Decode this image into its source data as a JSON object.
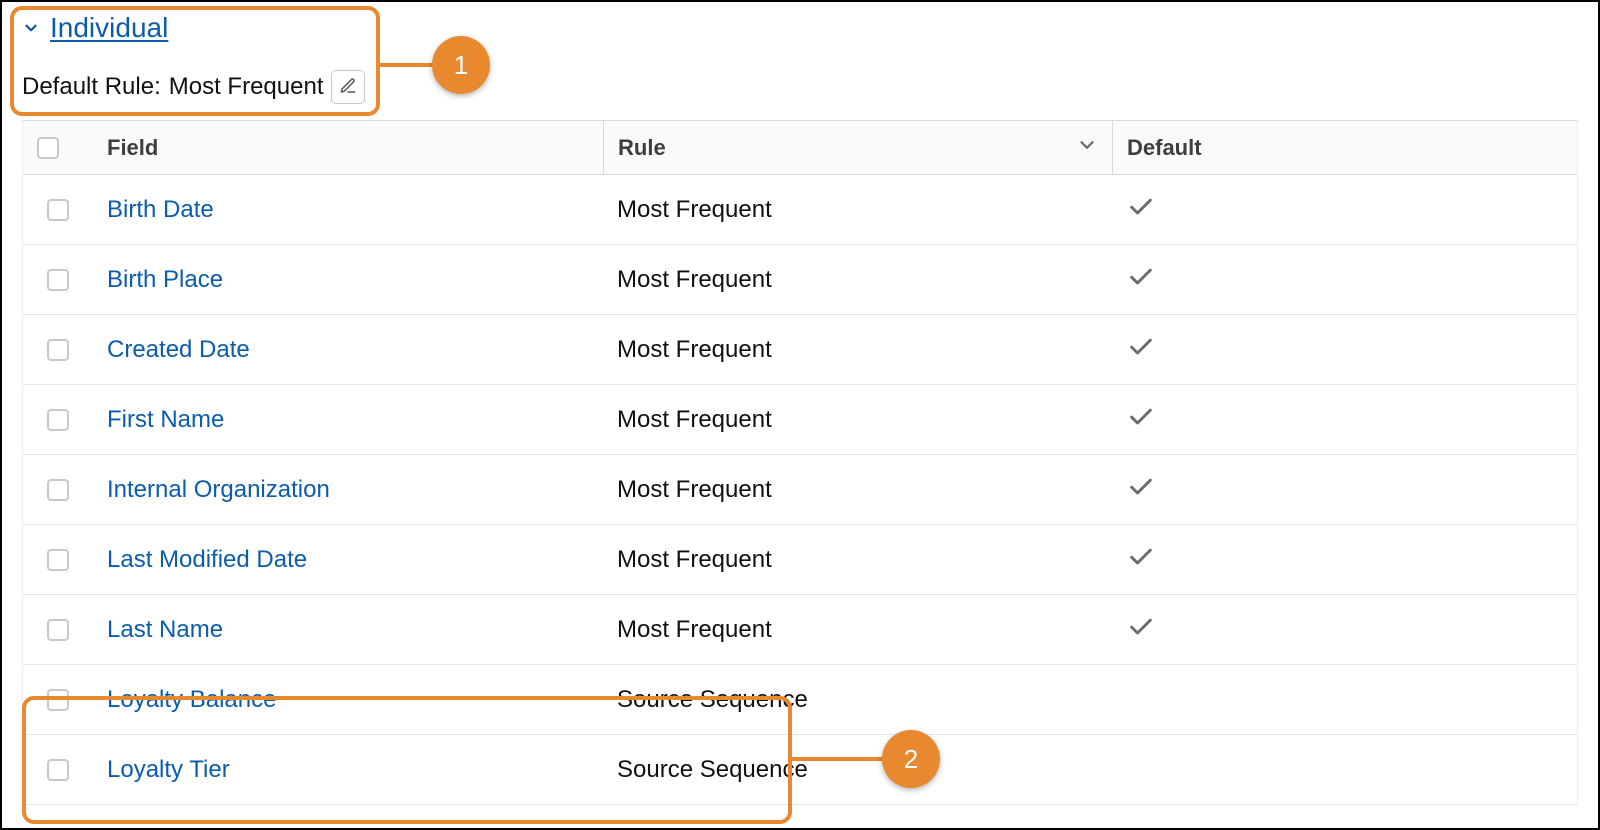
{
  "header": {
    "section_title": "Individual",
    "default_rule_label": "Default Rule:",
    "default_rule_value": "Most Frequent"
  },
  "annotations": {
    "badge1": "1",
    "badge2": "2"
  },
  "table": {
    "headers": {
      "field": "Field",
      "rule": "Rule",
      "default": "Default"
    },
    "rows": [
      {
        "field": "Birth Date",
        "rule": "Most Frequent",
        "default": true
      },
      {
        "field": "Birth Place",
        "rule": "Most Frequent",
        "default": true
      },
      {
        "field": "Created Date",
        "rule": "Most Frequent",
        "default": true
      },
      {
        "field": "First Name",
        "rule": "Most Frequent",
        "default": true
      },
      {
        "field": "Internal Organization",
        "rule": "Most Frequent",
        "default": true
      },
      {
        "field": "Last Modified Date",
        "rule": "Most Frequent",
        "default": true
      },
      {
        "field": "Last Name",
        "rule": "Most Frequent",
        "default": true
      },
      {
        "field": "Loyalty Balance",
        "rule": "Source Sequence",
        "default": false
      },
      {
        "field": "Loyalty Tier",
        "rule": "Source Sequence",
        "default": false
      }
    ]
  }
}
